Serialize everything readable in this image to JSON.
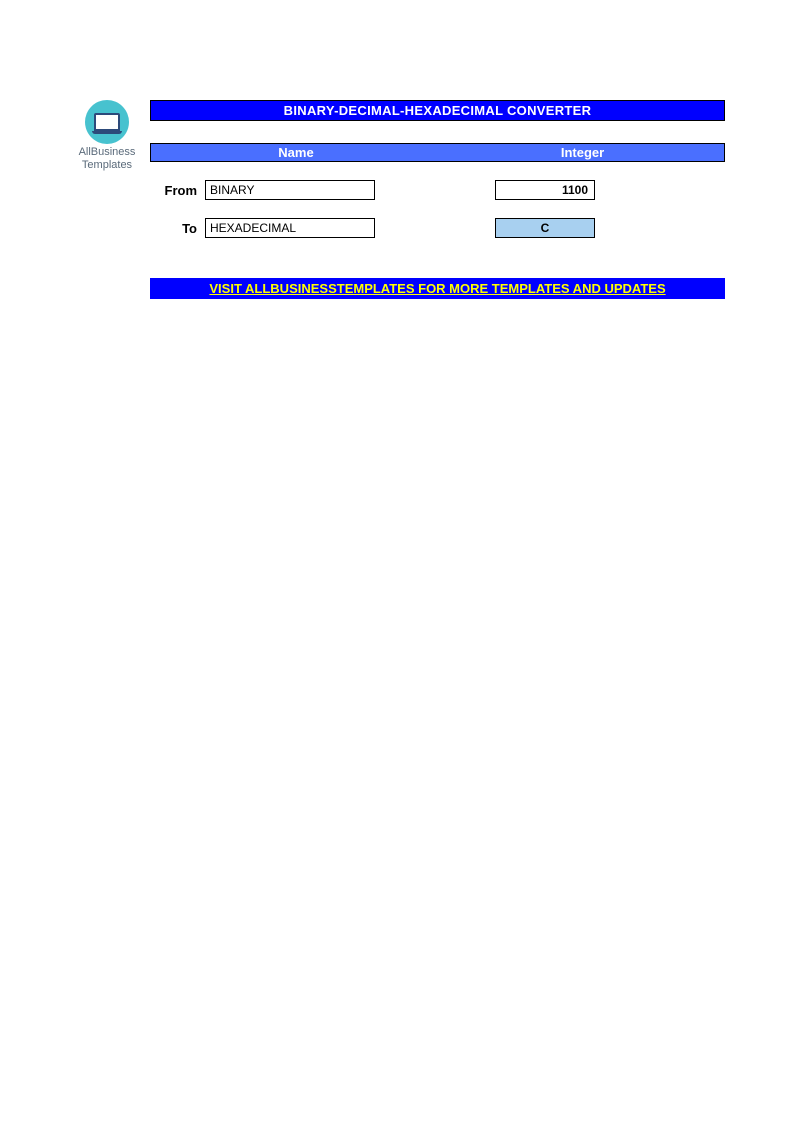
{
  "logo": {
    "line1": "AllBusiness",
    "line2": "Templates",
    "icon_name": "laptop-icon"
  },
  "title": "BINARY-DECIMAL-HEXADECIMAL CONVERTER",
  "headers": {
    "name": "Name",
    "integer": "Integer"
  },
  "rows": {
    "from": {
      "label": "From",
      "name_value": "BINARY",
      "integer_value": "1100"
    },
    "to": {
      "label": "To",
      "name_value": "HEXADECIMAL",
      "integer_value": "C"
    }
  },
  "link_text": "VISIT ALLBUSINESSTEMPLATES FOR MORE TEMPLATES AND UPDATES",
  "colors": {
    "title_bg": "#0000ff",
    "header_bg": "#4a6fff",
    "result_bg": "#a8d0f0",
    "link_fg": "#ffff00"
  }
}
